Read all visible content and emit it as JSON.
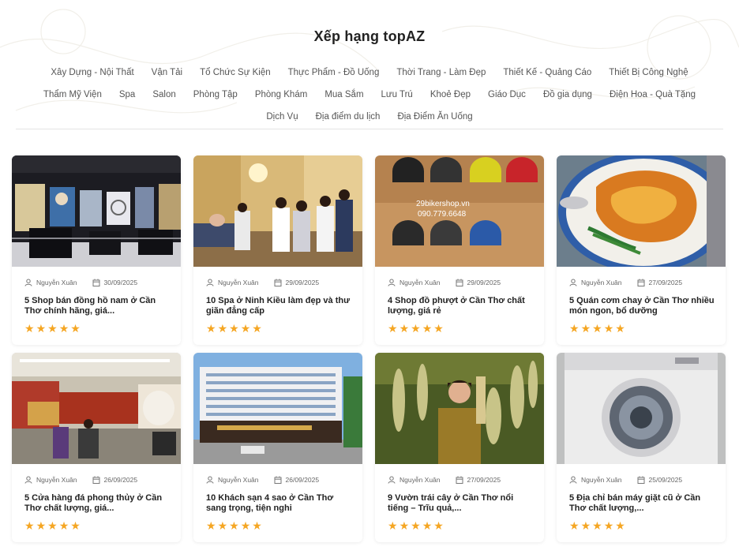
{
  "page_title": "Xếp hạng topAZ",
  "categories": [
    "Xây Dựng - Nội Thất",
    "Vận Tải",
    "Tổ Chức Sự Kiện",
    "Thực Phẩm - Đồ Uống",
    "Thời Trang - Làm Đẹp",
    "Thiết Kế - Quảng Cáo",
    "Thiết Bị Công Nghệ",
    "Thẩm Mỹ Viện",
    "Spa",
    "Salon",
    "Phòng Tập",
    "Phòng Khám",
    "Mua Sắm",
    "Lưu Trú",
    "Khoẻ Đẹp",
    "Giáo Dục",
    "Đồ gia dụng",
    "Điện Hoa - Quà Tặng",
    "Dịch Vụ",
    "Địa điểm du lịch",
    "Địa Điểm Ăn Uống"
  ],
  "cards": [
    {
      "author": "Nguyễn Xuân",
      "date": "30/09/2025",
      "title": "5 Shop bán đồng hồ nam ở Cần Thơ chính hãng, giá...",
      "rating": 5,
      "image": "watch-store-photo"
    },
    {
      "author": "Nguyễn Xuân",
      "date": "29/09/2025",
      "title": "10 Spa ở Ninh Kiều làm đẹp và thư giãn đẳng cấp",
      "rating": 5,
      "image": "spa-photo"
    },
    {
      "author": "Nguyễn Xuân",
      "date": "29/09/2025",
      "title": "4 Shop đồ phượt ở Cần Thơ chất lượng, giá rẻ",
      "rating": 5,
      "image": "helmet-shop-photo",
      "image_caption": [
        "29bikershop.vn",
        "090.779.6648"
      ]
    },
    {
      "author": "Nguyễn Xuân",
      "date": "27/09/2025",
      "title": "5 Quán cơm chay ở Cần Thơ nhiều món ngon, bổ dưỡng",
      "rating": 5,
      "image": "vegetarian-rice-photo"
    },
    {
      "author": "Nguyễn Xuân",
      "date": "26/09/2025",
      "title": "5 Cửa hàng đá phong thủy ở Cần Thơ chất lượng, giá...",
      "rating": 5,
      "image": "feng-shui-store-photo"
    },
    {
      "author": "Nguyễn Xuân",
      "date": "26/09/2025",
      "title": "10 Khách sạn 4 sao ở Cần Thơ sang trọng, tiện nghi",
      "rating": 5,
      "image": "hotel-photo"
    },
    {
      "author": "Nguyễn Xuân",
      "date": "27/09/2025",
      "title": "9 Vườn trái cây ở Cần Thơ nổi tiếng – Trĩu quả,...",
      "rating": 5,
      "image": "fruit-garden-photo"
    },
    {
      "author": "Nguyễn Xuân",
      "date": "25/09/2025",
      "title": "5 Địa chỉ bán máy giặt cũ ở Cần Thơ chất lượng,...",
      "rating": 5,
      "image": "washing-machine-photo"
    }
  ],
  "colors": {
    "star": "#f5a623",
    "title_text": "#222222",
    "meta_text": "#666666"
  }
}
